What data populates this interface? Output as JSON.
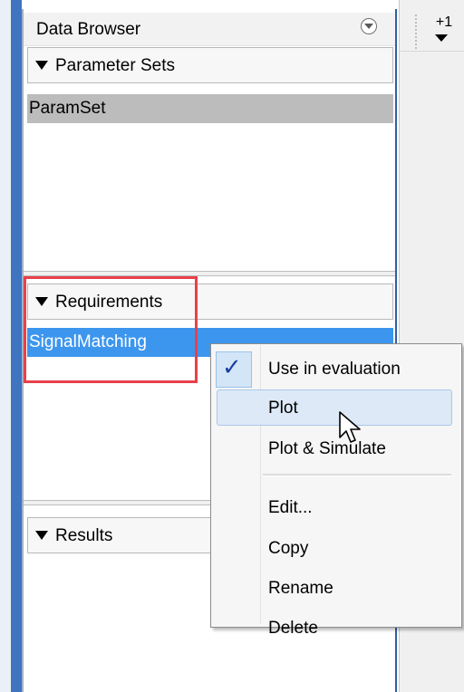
{
  "data_browser": {
    "title": "Data Browser",
    "menu_icon": "circle-chevron-down-icon",
    "sections": {
      "parameter_sets": {
        "label": "Parameter Sets",
        "items": [
          "ParamSet"
        ]
      },
      "requirements": {
        "label": "Requirements",
        "items": [
          "SignalMatching"
        ]
      },
      "results": {
        "label": "Results",
        "items": []
      }
    }
  },
  "toolbar": {
    "step_label": "+1"
  },
  "context_menu": {
    "items": [
      {
        "label": "Use in evaluation",
        "checked": true
      },
      {
        "label": "Plot",
        "highlighted": true
      },
      {
        "label": "Plot & Simulate"
      },
      {
        "label": "Edit..."
      },
      {
        "label": "Copy"
      },
      {
        "label": "Rename"
      },
      {
        "label": "Delete"
      }
    ]
  },
  "colors": {
    "selection_blue": "#3d96ee",
    "highlight_red": "#e8404a",
    "param_row_gray": "#bcbcbc"
  }
}
